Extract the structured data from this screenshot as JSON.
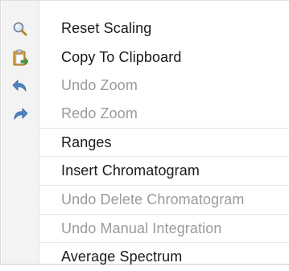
{
  "menu": {
    "items": [
      {
        "label": "Reset Scaling",
        "icon": "magnifier-icon",
        "enabled": true
      },
      {
        "label": "Copy To Clipboard",
        "icon": "clipboard-icon",
        "enabled": true
      },
      {
        "label": "Undo Zoom",
        "icon": "undo-arrow-icon",
        "enabled": false
      },
      {
        "label": "Redo Zoom",
        "icon": "redo-arrow-icon",
        "enabled": false
      },
      {
        "label": "Ranges",
        "icon": "",
        "enabled": true
      },
      {
        "label": "Insert Chromatogram",
        "icon": "",
        "enabled": true
      },
      {
        "label": "Undo Delete Chromatogram",
        "icon": "",
        "enabled": false
      },
      {
        "label": "Undo Manual Integration",
        "icon": "",
        "enabled": false
      },
      {
        "label": "Average Spectrum",
        "icon": "",
        "enabled": true
      }
    ]
  },
  "colors": {
    "enabled_text": "#1a1a1a",
    "disabled_text": "#9b9b9b",
    "gutter": "#f3f3f3",
    "icon_blue": "#3a78c2"
  }
}
